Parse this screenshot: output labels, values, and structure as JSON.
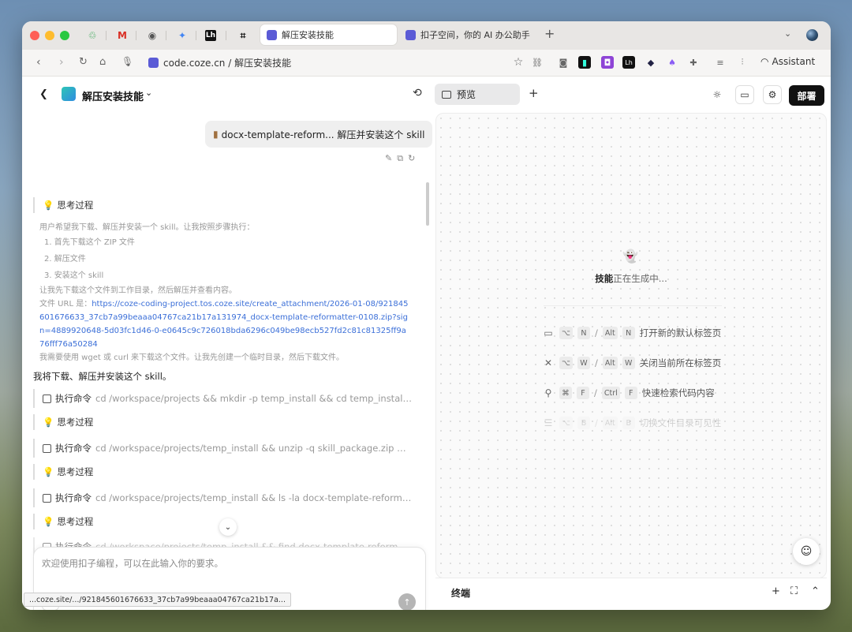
{
  "browser": {
    "tabs": [
      {
        "title": "解压安装技能",
        "active": true
      },
      {
        "title": "扣子空间，你的 AI 办公助手",
        "active": false
      }
    ],
    "pinned_tab_icons": [
      "chrome-webstore-icon",
      "gmail-icon",
      "ai-icon",
      "gemini-icon",
      "lovart-icon",
      "notion-icon"
    ],
    "address": "code.coze.cn / 解压安装技能",
    "assistant_label": "Assistant",
    "status_url": "...coze.site/.../921845601676633_37cb7a99beaaa04767ca21b17a..."
  },
  "header": {
    "project_name": "解压安装技能",
    "preview_tab": "预览",
    "deploy_label": "部署"
  },
  "chat": {
    "user_message": "docx-template-reform... 解压并安装这个 skill",
    "think_label": "思考过程",
    "thought": {
      "intro": "用户希望我下载、解压并安装一个 skill。让我按照步骤执行：",
      "steps": [
        "1. 首先下载这个 ZIP 文件",
        "2. 解压文件",
        "3. 安装这个 skill"
      ],
      "plan": "让我先下载这个文件到工作目录，然后解压并查看内容。",
      "url_label": "文件 URL 是：",
      "url": "https://coze-coding-project.tos.coze.site/create_attachment/2026-01-08/921845601676633_37cb7a99beaaa04767ca21b17a131974_docx-template-reformatter-0108.zip?sign=4889920648-5d03fc1d46-0-e0645c9c726018bda6296c049be98ecb527fd2c81c81325ff9a76fff76a50284",
      "tools": "我需要使用 wget 或 curl 来下载这个文件。让我先创建一个临时目录，然后下载文件。"
    },
    "reply": "我将下载、解压并安装这个 skill。",
    "cmd_label": "执行命令",
    "commands": [
      "cd /workspace/projects && mkdir -p temp_install && cd temp_install && wg...",
      "cd /workspace/projects/temp_install && unzip -q skill_package.zip && ls -la",
      "cd /workspace/projects/temp_install && ls -la docx-template-reformatter-0...",
      "cd /workspace/projects/temp_install && find docx-template-reformatter-01..."
    ],
    "input_placeholder": "欢迎使用扣子编程，可以在此输入你的要求。"
  },
  "preview": {
    "status_strong": "技能",
    "status_rest": "正在生成中...",
    "shortcuts": [
      {
        "icon": "window-icon",
        "mac": [
          "⌥",
          "N"
        ],
        "win": [
          "Alt",
          "N"
        ],
        "label": "打开新的默认标签页"
      },
      {
        "icon": "close-icon",
        "mac": [
          "⌥",
          "W"
        ],
        "win": [
          "Alt",
          "W"
        ],
        "label": "关闭当前所在标签页"
      },
      {
        "icon": "search-icon",
        "mac": [
          "⌘",
          "F"
        ],
        "win": [
          "Ctrl",
          "F"
        ],
        "label": "快速检索代码内容"
      },
      {
        "icon": "list-icon",
        "mac": [
          "⌥",
          "B"
        ],
        "win": [
          "Alt",
          "B"
        ],
        "label": "切换文件目录可见性"
      }
    ],
    "terminal_label": "终端"
  },
  "colors": {
    "accent": "#5b5bd6",
    "deploy": "#111111",
    "link": "#3b6fd8"
  }
}
